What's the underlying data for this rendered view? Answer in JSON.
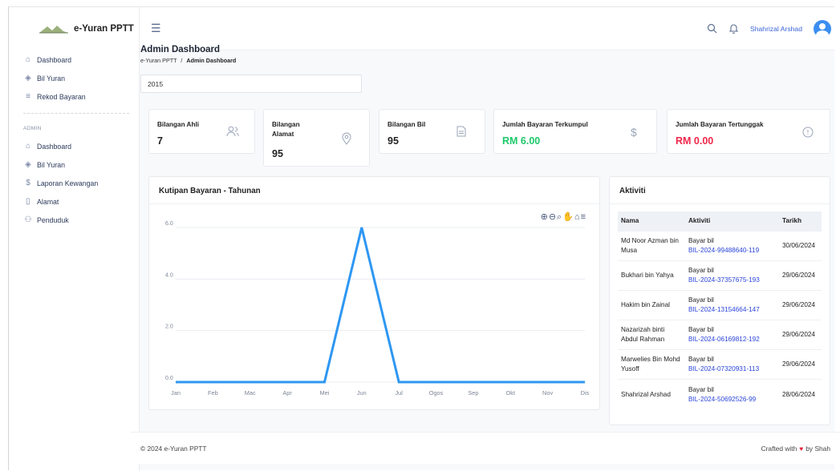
{
  "app": {
    "name": "e-Yuran PPTT"
  },
  "sidebar": {
    "main": [
      {
        "label": "Dashboard",
        "icon": "home-icon"
      },
      {
        "label": "Bil Yuran",
        "icon": "layers-icon"
      },
      {
        "label": "Rekod Bayaran",
        "icon": "list-icon"
      }
    ],
    "admin_heading": "ADMIN",
    "admin": [
      {
        "label": "Dashboard",
        "icon": "home-icon"
      },
      {
        "label": "Bil Yuran",
        "icon": "layers-icon"
      },
      {
        "label": "Laporan Kewangan",
        "icon": "dollar-icon"
      },
      {
        "label": "Alamat",
        "icon": "map-icon"
      },
      {
        "label": "Penduduk",
        "icon": "users-icon"
      }
    ]
  },
  "header": {
    "user_name": "Shahrizal Arshad"
  },
  "page": {
    "title": "Admin Dashboard",
    "breadcrumb": [
      "e-Yuran PPTT",
      "/",
      "Admin Dashboard"
    ],
    "year": "2015"
  },
  "stats": [
    {
      "label": "Bilangan Ahli",
      "value": "7",
      "icon": "users-icon"
    },
    {
      "label": "Bilangan Alamat",
      "value": "95",
      "icon": "map-pin-icon"
    },
    {
      "label": "Bilangan Bil",
      "value": "95",
      "icon": "file-icon"
    },
    {
      "label": "Jumlah Bayaran Terkumpul",
      "value": "RM 6.00",
      "icon": "dollar-icon",
      "color": "#1ec96b"
    },
    {
      "label": "Jumlah Bayaran Tertunggak",
      "value": "RM 0.00",
      "icon": "alert-circle-icon",
      "color": "#f0264a"
    }
  ],
  "chart_panel": {
    "title": "Kutipan Bayaran - Tahunan"
  },
  "chart_data": {
    "type": "line",
    "categories": [
      "Jan",
      "Feb",
      "Mac",
      "Apr",
      "Mei",
      "Jun",
      "Jul",
      "Ogos",
      "Sep",
      "Okt",
      "Nov",
      "Dis"
    ],
    "series": [
      {
        "values": [
          0,
          0,
          0,
          0,
          0,
          6,
          0,
          0,
          0,
          0,
          0,
          0
        ]
      }
    ],
    "yticks": [
      "0.0",
      "2.0",
      "4.0",
      "6.0"
    ],
    "ylim": [
      0,
      6
    ],
    "color": "#2e97f2",
    "grid": true
  },
  "activity": {
    "title": "Aktiviti",
    "columns": [
      "Nama",
      "Aktiviti",
      "Tarikh"
    ],
    "rows": [
      {
        "name": "Md Noor Azman bin Musa",
        "action": "Bayar bil",
        "bill": "BIL-2024-99488640-119",
        "date": "30/06/2024"
      },
      {
        "name": "Bukhari bin Yahya",
        "action": "Bayar bil",
        "bill": "BIL-2024-37357675-193",
        "date": "29/06/2024"
      },
      {
        "name": "Hakim bin Zainal",
        "action": "Bayar bil",
        "bill": "BIL-2024-13154664-147",
        "date": "29/06/2024"
      },
      {
        "name": "Nazarizah binti Abdul Rahman",
        "action": "Bayar bil",
        "bill": "BIL-2024-06169812-192",
        "date": "29/06/2024"
      },
      {
        "name": "Marwelies Bin Mohd Yusoff",
        "action": "Bayar bil",
        "bill": "BIL-2024-07320931-113",
        "date": "29/06/2024"
      },
      {
        "name": "Shahrizal Arshad",
        "action": "Bayar bil",
        "bill": "BIL-2024-50692526-99",
        "date": "28/06/2024"
      }
    ]
  },
  "footer": {
    "left": "© 2024 e-Yuran PPTT",
    "right_pre": "Crafted with",
    "right_post": "by Shah"
  }
}
